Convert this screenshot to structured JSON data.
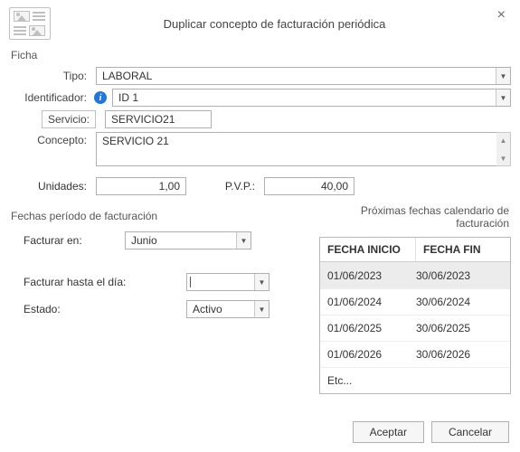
{
  "title": "Duplicar concepto de facturación periódica",
  "close_glyph": "×",
  "section_ficha": "Ficha",
  "ficha": {
    "tipo_label": "Tipo:",
    "tipo_value": "LABORAL",
    "ident_label": "Identificador:",
    "ident_value": "ID 1",
    "servicio_label": "Servicio:",
    "servicio_value": "SERVICIO21",
    "concepto_label": "Concepto:",
    "concepto_value": "SERVICIO 21",
    "unidades_label": "Unidades:",
    "unidades_value": "1,00",
    "pvp_label": "P.V.P.:",
    "pvp_value": "40,00"
  },
  "section_periodo": "Fechas período de facturación",
  "facturar_en_label": "Facturar en:",
  "facturar_en_value": "Junio",
  "facturar_hasta_label": "Facturar hasta el día:",
  "facturar_hasta_value": "",
  "estado_label": "Estado:",
  "estado_value": "Activo",
  "section_proximas": "Próximas fechas calendario de facturación",
  "grid": {
    "col1": "FECHA INICIO",
    "col2": "FECHA FIN",
    "rows": [
      {
        "inicio": "01/06/2023",
        "fin": "30/06/2023"
      },
      {
        "inicio": "01/06/2024",
        "fin": "30/06/2024"
      },
      {
        "inicio": "01/06/2025",
        "fin": "30/06/2025"
      },
      {
        "inicio": "01/06/2026",
        "fin": "30/06/2026"
      }
    ],
    "etc": "Etc..."
  },
  "buttons": {
    "aceptar": "Aceptar",
    "cancelar": "Cancelar"
  },
  "glyph": {
    "down": "▼",
    "up": "▲",
    "info": "i"
  }
}
